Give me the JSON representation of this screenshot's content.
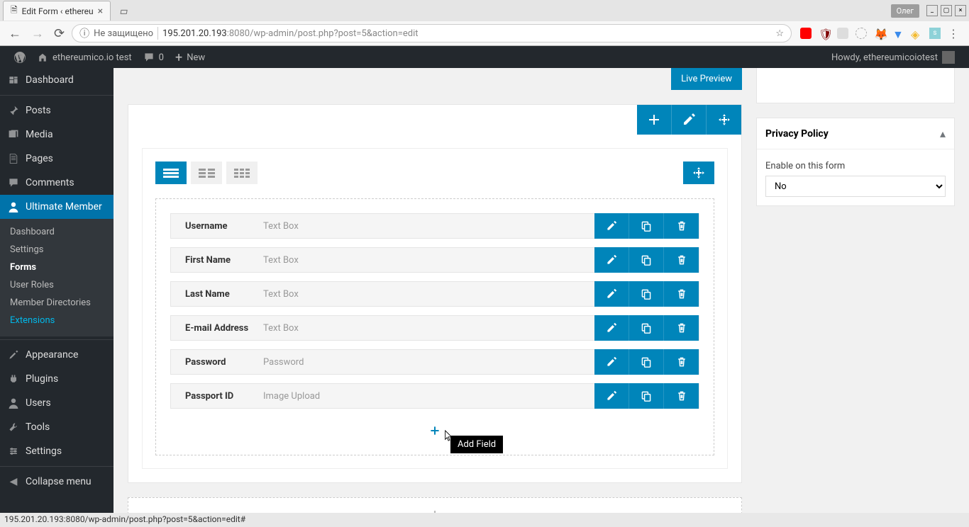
{
  "browser": {
    "tab_title": "Edit Form ‹ ethereu",
    "profile": "Олег",
    "url_warning": "Не защищено",
    "url_host": "195.201.20.193",
    "url_port": ":8080",
    "url_path": "/wp-admin/post.php?post=5&action=edit"
  },
  "adminbar": {
    "site_name": "ethereumico.io test",
    "comments_count": "0",
    "new_label": "New",
    "howdy": "Howdy, ethereumicoiotest"
  },
  "sidebar": {
    "items": [
      {
        "label": "Dashboard",
        "icon": "dashboard"
      },
      {
        "label": "Posts",
        "icon": "pin"
      },
      {
        "label": "Media",
        "icon": "media"
      },
      {
        "label": "Pages",
        "icon": "pages"
      },
      {
        "label": "Comments",
        "icon": "comments"
      },
      {
        "label": "Ultimate Member",
        "icon": "user",
        "current": true
      },
      {
        "label": "Appearance",
        "icon": "brush"
      },
      {
        "label": "Plugins",
        "icon": "plug"
      },
      {
        "label": "Users",
        "icon": "users"
      },
      {
        "label": "Tools",
        "icon": "tools"
      },
      {
        "label": "Settings",
        "icon": "settings"
      }
    ],
    "submenu": [
      {
        "label": "Dashboard"
      },
      {
        "label": "Settings"
      },
      {
        "label": "Forms",
        "active": true
      },
      {
        "label": "User Roles"
      },
      {
        "label": "Member Directories"
      },
      {
        "label": "Extensions",
        "highlight": true
      }
    ],
    "collapse": "Collapse menu"
  },
  "content": {
    "live_preview": "Live Preview",
    "fields": [
      {
        "label": "Username",
        "type": "Text Box"
      },
      {
        "label": "First Name",
        "type": "Text Box"
      },
      {
        "label": "Last Name",
        "type": "Text Box"
      },
      {
        "label": "E-mail Address",
        "type": "Text Box"
      },
      {
        "label": "Password",
        "type": "Password"
      },
      {
        "label": "Passport ID",
        "type": "Image Upload"
      }
    ],
    "add_field_tooltip": "Add Field"
  },
  "sidebox": {
    "title": "Privacy Policy",
    "label": "Enable on this form",
    "options": [
      "No"
    ],
    "value": "No"
  },
  "status_bar": "195.201.20.193:8080/wp-admin/post.php?post=5&action=edit#"
}
